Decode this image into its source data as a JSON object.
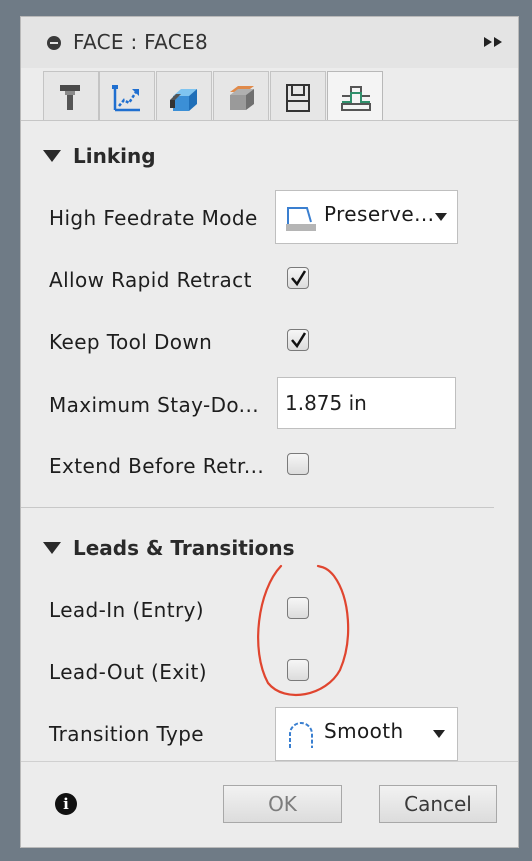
{
  "dialog": {
    "title": "FACE : FACE8",
    "tabs": [
      {
        "name": "tool",
        "icon": "tool-icon"
      },
      {
        "name": "geometry",
        "icon": "geometry-icon"
      },
      {
        "name": "heights",
        "icon": "heights-icon"
      },
      {
        "name": "passes",
        "icon": "passes-icon"
      },
      {
        "name": "stock",
        "icon": "stock-icon"
      },
      {
        "name": "linking",
        "icon": "linking-icon",
        "active": true
      }
    ]
  },
  "linking": {
    "heading": "Linking",
    "high_feedrate_mode": {
      "label": "High Feedrate Mode",
      "value": "Preserve..."
    },
    "allow_rapid_retract": {
      "label": "Allow Rapid Retract",
      "checked": true
    },
    "keep_tool_down": {
      "label": "Keep Tool Down",
      "checked": true
    },
    "maximum_stay_down": {
      "label": "Maximum Stay-Do...",
      "value": "1.875 in"
    },
    "extend_before_retract": {
      "label": "Extend Before Retr...",
      "checked": false
    }
  },
  "leads": {
    "heading": "Leads & Transitions",
    "lead_in": {
      "label": "Lead-In (Entry)",
      "checked": false
    },
    "lead_out": {
      "label": "Lead-Out (Exit)",
      "checked": false
    },
    "transition_type": {
      "label": "Transition Type",
      "value": "Smooth"
    }
  },
  "footer": {
    "ok_label": "OK",
    "cancel_label": "Cancel",
    "info_glyph": "i"
  },
  "colors": {
    "annotation": "#e0452f",
    "background": "#6f7b86",
    "panel": "#ececec",
    "linking_tab_icon": "#2f8f6b"
  }
}
